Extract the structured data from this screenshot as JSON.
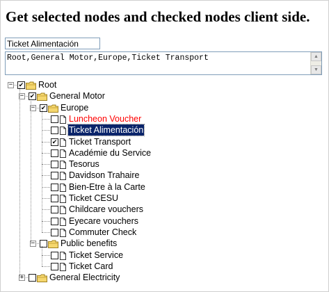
{
  "header": {
    "title": "Get selected nodes and checked nodes client side."
  },
  "selected_input": {
    "value": "Ticket Alimentación"
  },
  "checked_output": {
    "value": "Root,General Motor,Europe,Ticket Transport"
  },
  "tree": {
    "root": {
      "label": "Root",
      "checked": true,
      "expanded": true
    },
    "general_motor": {
      "label": "General Motor",
      "checked": true,
      "expanded": true
    },
    "europe": {
      "label": "Europe",
      "checked": true,
      "expanded": true
    },
    "europe_items": [
      {
        "label": "Luncheon Voucher",
        "checked": false,
        "color": "#ff0000"
      },
      {
        "label": "Ticket Alimentación",
        "checked": false,
        "selected": true
      },
      {
        "label": "Ticket Transport",
        "checked": true
      },
      {
        "label": "Académie du Service",
        "checked": false
      },
      {
        "label": "Tesorus",
        "checked": false
      },
      {
        "label": "Davidson Trahaire",
        "checked": false
      },
      {
        "label": "Bien-Etre à la Carte",
        "checked": false
      },
      {
        "label": "Ticket CESU",
        "checked": false
      },
      {
        "label": "Childcare vouchers",
        "checked": false
      },
      {
        "label": "Eyecare vouchers",
        "checked": false
      },
      {
        "label": "Commuter Check",
        "checked": false
      }
    ],
    "public_benefits": {
      "label": "Public benefits",
      "checked": false,
      "expanded": true
    },
    "public_items": [
      {
        "label": "Ticket Service",
        "checked": false
      },
      {
        "label": "Ticket Card",
        "checked": false
      }
    ],
    "general_electricity": {
      "label": "General Electricity",
      "checked": false,
      "expanded": false
    }
  },
  "icons": {
    "folder": "folder-icon",
    "document": "document-icon",
    "expand": "plus-icon",
    "collapse": "minus-icon"
  },
  "colors": {
    "selection_bg": "#0a246a",
    "folder": "#f5d76e",
    "highlight_text": "#ff0000"
  }
}
